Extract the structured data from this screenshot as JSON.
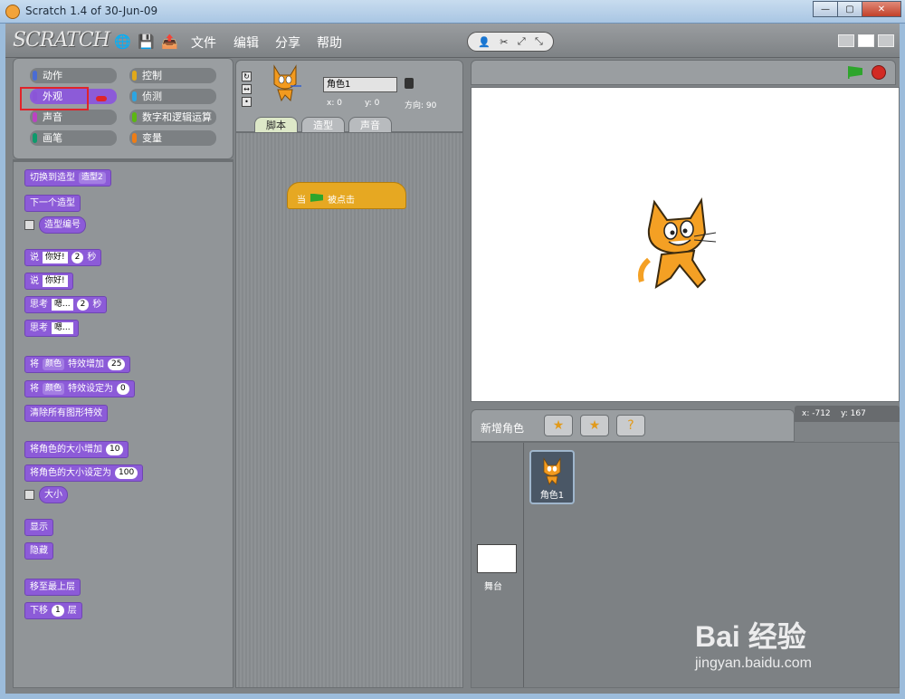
{
  "window": {
    "title": "Scratch 1.4 of 30-Jun-09",
    "min": "—",
    "max": "▢",
    "close": "✕"
  },
  "menubar": {
    "logo": "SCRATCH",
    "items": [
      "文件",
      "编辑",
      "分享",
      "帮助"
    ],
    "icons": [
      "globe-icon",
      "save-icon",
      "share-icon"
    ]
  },
  "categories": [
    {
      "label": "动作",
      "color": "#4a6cd4"
    },
    {
      "label": "控制",
      "color": "#e1a91a"
    },
    {
      "label": "外观",
      "color": "#8a55d7",
      "selected": true
    },
    {
      "label": "侦测",
      "color": "#2ca5e2"
    },
    {
      "label": "声音",
      "color": "#bb42c3"
    },
    {
      "label": "数字和逻辑运算",
      "color": "#5cb712"
    },
    {
      "label": "画笔",
      "color": "#0e9a6c"
    },
    {
      "label": "变量",
      "color": "#ee7d16"
    }
  ],
  "blocks": {
    "switch_costume": "切换到造型",
    "switch_costume_value": "造型2",
    "next_costume": "下一个造型",
    "costume_number": "造型编号",
    "say_for": "说",
    "say_for_text": "你好!",
    "say_for_secs": "2",
    "say_for_unit": "秒",
    "say": "说",
    "say_text": "你好!",
    "think_for": "思考",
    "think_for_text": "嗯...",
    "think_for_secs": "2",
    "think_for_unit": "秒",
    "think": "思考",
    "think_text": "嗯...",
    "change_effect_prefix": "将",
    "change_effect_dd": "颜色",
    "change_effect_suffix": "特效增加",
    "change_effect_val": "25",
    "set_effect_prefix": "将",
    "set_effect_dd": "颜色",
    "set_effect_suffix": "特效设定为",
    "set_effect_val": "0",
    "clear_effects": "清除所有图形特效",
    "change_size": "将角色的大小增加",
    "change_size_val": "10",
    "set_size": "将角色的大小设定为",
    "set_size_val": "100",
    "size": "大小",
    "show": "显示",
    "hide": "隐藏",
    "go_front": "移至最上层",
    "go_back": "下移",
    "go_back_val": "1",
    "go_back_unit": "层"
  },
  "sprite": {
    "name": "角色1",
    "x_label": "x: 0",
    "y_label": "y: 0",
    "direction_label": "方向: 90",
    "tabs": [
      "脚本",
      "造型",
      "声音"
    ]
  },
  "script": {
    "hat_prefix": "当",
    "hat_suffix": "被点击"
  },
  "stage": {
    "mouse_x": "x: -712",
    "mouse_y": "y: 167"
  },
  "sprite_list": {
    "new_sprite_label": "新增角色",
    "sprite_name": "角色1",
    "stage_label": "舞台"
  },
  "watermark": {
    "logo": "Bai 经验",
    "url": "jingyan.baidu.com"
  }
}
